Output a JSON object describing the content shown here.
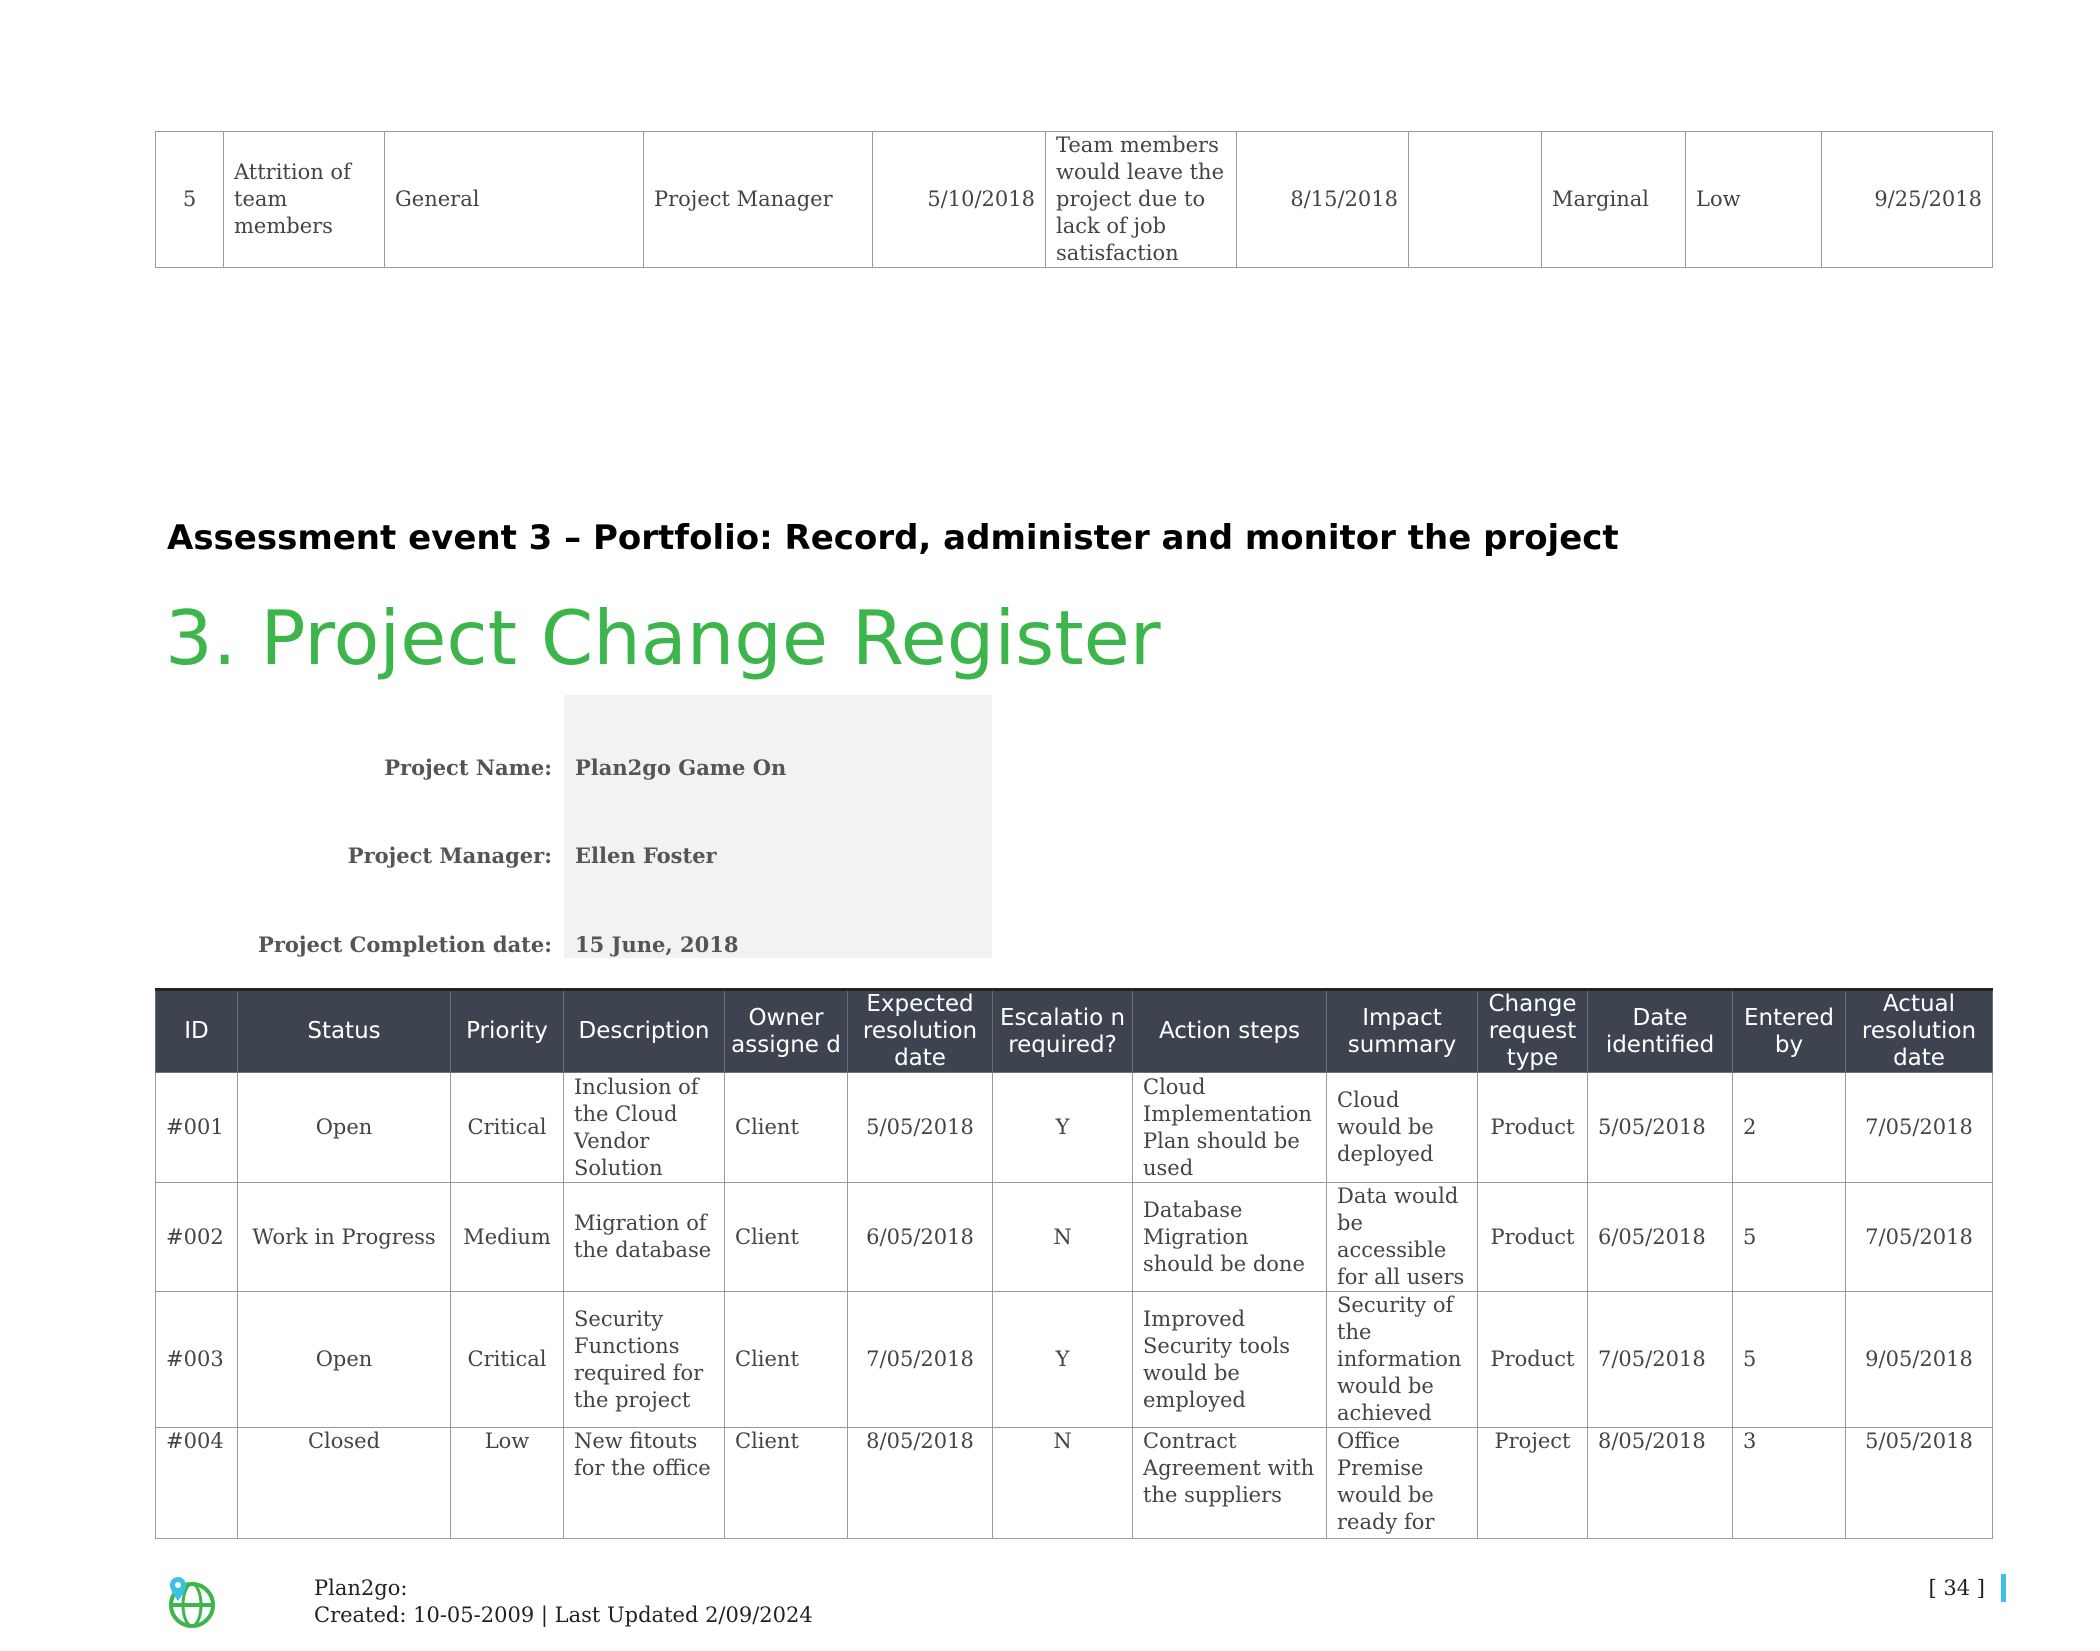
{
  "risk_row": {
    "id": "5",
    "risk": "Attrition of team members",
    "category": "General",
    "owner": "Project Manager",
    "date": "5/10/2018",
    "description": "Team members would leave the project due to lack of job satisfaction",
    "date2": "8/15/2018",
    "blank": "",
    "impact": "Marginal",
    "likelihood": "Low",
    "date3": "9/25/2018"
  },
  "section_heading": "Assessment event 3 – Portfolio: Record, administer and monitor the project",
  "page_title": "3. Project Change Register",
  "info": {
    "project_name_label": "Project Name:",
    "project_name": "Plan2go Game On",
    "project_manager_label": "Project Manager:",
    "project_manager": "Ellen Foster",
    "completion_label": "Project Completion date:",
    "completion_date": "15 June, 2018"
  },
  "change_table": {
    "headers": [
      "ID",
      "Status",
      "Priority",
      "Description",
      "Owner assigne d",
      "Expected resolution date",
      "Escalatio n required?",
      "Action steps",
      "Impact summary",
      "Change request type",
      "Date identified",
      "Entered by",
      "Actual resolution date"
    ],
    "rows": [
      [
        "#001",
        "Open",
        "Critical",
        "Inclusion of the Cloud Vendor Solution",
        "Client",
        "5/05/2018",
        "Y",
        "Cloud Implementation Plan should be used",
        "Cloud would be deployed",
        "Product",
        "5/05/2018",
        "2",
        "7/05/2018"
      ],
      [
        "#002",
        "Work in Progress",
        "Medium",
        "Migration of the database",
        "Client",
        "6/05/2018",
        "N",
        "Database Migration should be done",
        "Data would be accessible for all users",
        "Product",
        "6/05/2018",
        "5",
        "7/05/2018"
      ],
      [
        "#003",
        "Open",
        "Critical",
        "Security Functions required for the project",
        "Client",
        "7/05/2018",
        "Y",
        "Improved Security tools would be employed",
        "Security of the information would be achieved",
        "Product",
        "7/05/2018",
        "5",
        "9/05/2018"
      ],
      [
        "#004",
        "Closed",
        "Low",
        "New fitouts for the office",
        "Client",
        "8/05/2018",
        "N",
        "Contract Agreement with the suppliers",
        "Office Premise would be ready for",
        "Project",
        "8/05/2018",
        "3",
        "5/05/2018"
      ]
    ]
  },
  "footer": {
    "company": "Plan2go:",
    "created": "Created: 10-05-2009 | Last Updated 2/09/2024",
    "page_number": "[ 34 ]",
    "logo_icon": "globe-pin-icon"
  },
  "colors": {
    "title_green": "#3cb54a",
    "header_bg": "#3d4450",
    "accent_blue": "#3cc0e6"
  }
}
